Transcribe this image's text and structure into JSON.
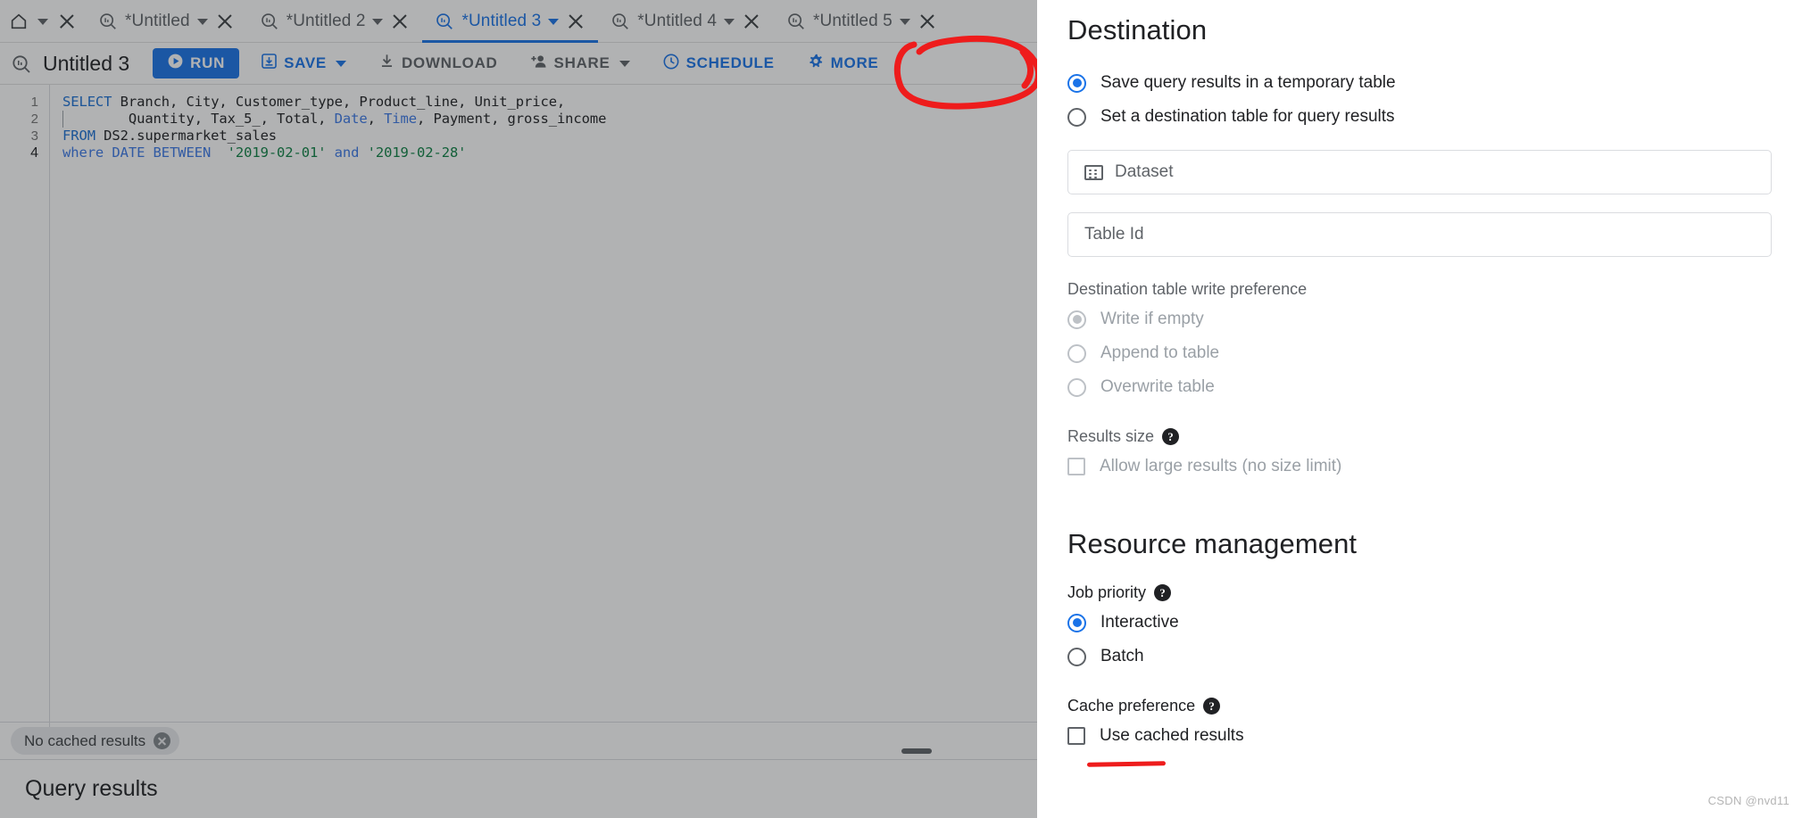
{
  "app": {
    "watermark": "CSDN @nvd11"
  },
  "tabs": [
    {
      "label": "",
      "icon": "home-icon",
      "has_caret": true,
      "has_close": true,
      "active": false
    },
    {
      "label": "*Untitled",
      "icon": "query-icon",
      "has_caret": true,
      "has_close": true,
      "active": false
    },
    {
      "label": "*Untitled 2",
      "icon": "query-icon",
      "has_caret": true,
      "has_close": true,
      "active": false
    },
    {
      "label": "*Untitled 3",
      "icon": "query-icon",
      "has_caret": true,
      "has_close": true,
      "active": true
    },
    {
      "label": "*Untitled 4",
      "icon": "query-icon",
      "has_caret": true,
      "has_close": true,
      "active": false
    },
    {
      "label": "*Untitled 5",
      "icon": "query-icon",
      "has_caret": true,
      "has_close": true,
      "active": false
    }
  ],
  "toolbar": {
    "query_title": "Untitled 3",
    "query_icon": "query-icon",
    "run_label": "RUN",
    "save_label": "SAVE",
    "download_label": "DOWNLOAD",
    "share_label": "SHARE",
    "schedule_label": "SCHEDULE",
    "more_label": "MORE",
    "accent_color": "#1a73e8",
    "muted_color": "#5f6368"
  },
  "editor": {
    "line_numbers": [
      "1",
      "2",
      "3",
      "4"
    ],
    "lines": [
      [
        {
          "t": "SELECT",
          "c": "kw"
        },
        {
          "t": " Branch, City, Customer_type, Product_line, Unit_price,",
          "c": "plain"
        }
      ],
      [
        {
          "t": "        Quantity, Tax_5_, Total, ",
          "c": "plain"
        },
        {
          "t": "Date",
          "c": "kw2"
        },
        {
          "t": ", ",
          "c": "plain"
        },
        {
          "t": "Time",
          "c": "kw2"
        },
        {
          "t": ", Payment, gross_income",
          "c": "plain"
        }
      ],
      [
        {
          "t": "FROM",
          "c": "kw"
        },
        {
          "t": " DS2.supermarket_sales",
          "c": "plain"
        }
      ],
      [
        {
          "t": "where DATE BETWEEN",
          "c": "kw2"
        },
        {
          "t": "  ",
          "c": "plain"
        },
        {
          "t": "'2019-02-01'",
          "c": "str"
        },
        {
          "t": " and ",
          "c": "kw2"
        },
        {
          "t": "'2019-02-28'",
          "c": "str"
        }
      ]
    ]
  },
  "status": {
    "cached_chip": "No cached results",
    "results_heading": "Query results"
  },
  "panel": {
    "destination": {
      "heading": "Destination",
      "options": [
        {
          "label": "Save query results in a temporary table",
          "checked": true,
          "disabled": false
        },
        {
          "label": "Set a destination table for query results",
          "checked": false,
          "disabled": false
        }
      ],
      "dataset_placeholder": "Dataset",
      "table_id_placeholder": "Table Id",
      "write_pref_label": "Destination table write preference",
      "write_pref_options": [
        {
          "label": "Write if empty",
          "checked": true,
          "disabled": true
        },
        {
          "label": "Append to table",
          "checked": false,
          "disabled": true
        },
        {
          "label": "Overwrite table",
          "checked": false,
          "disabled": true
        }
      ],
      "results_size_label": "Results size",
      "allow_large_results_label": "Allow large results (no size limit)",
      "allow_large_results_checked": false,
      "allow_large_results_disabled": true
    },
    "resource": {
      "heading": "Resource management",
      "job_priority_label": "Job priority",
      "job_priority_options": [
        {
          "label": "Interactive",
          "checked": true,
          "disabled": false
        },
        {
          "label": "Batch",
          "checked": false,
          "disabled": false
        }
      ],
      "cache_pref_label": "Cache preference",
      "use_cached_label": "Use cached results",
      "use_cached_checked": false
    }
  },
  "annotations": {
    "circle_target": "MORE",
    "color": "#ee1c1c"
  }
}
